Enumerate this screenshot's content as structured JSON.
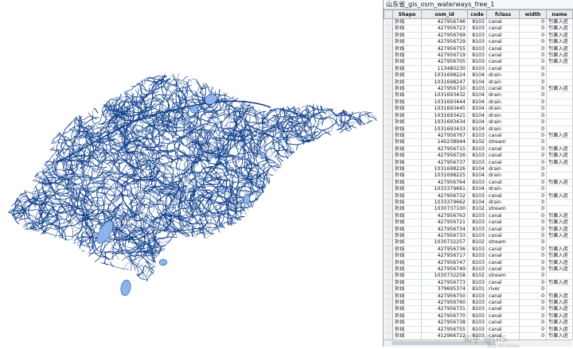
{
  "window": {
    "title": "山东省_gis_osm_waterways_free_1"
  },
  "map": {
    "waterway_color": "#0d3d8a",
    "waterbody_color": "#8cb4ea",
    "background_color": "#ffffff"
  },
  "table": {
    "columns": [
      "Shape",
      "osm_id",
      "code",
      "fclass",
      "width",
      "name"
    ],
    "rows": [
      [
        "折线",
        "427956746",
        "8103",
        "canal",
        "0",
        "引黄入运"
      ],
      [
        "折线",
        "427956723",
        "8103",
        "canal",
        "0",
        "引黄入运"
      ],
      [
        "折线",
        "427956769",
        "8103",
        "canal",
        "0",
        "引黄入运"
      ],
      [
        "折线",
        "427956729",
        "8103",
        "canal",
        "0",
        "引黄入运"
      ],
      [
        "折线",
        "427956755",
        "8103",
        "canal",
        "0",
        "引黄入运"
      ],
      [
        "折线",
        "427956719",
        "8103",
        "canal",
        "0",
        "引黄入运"
      ],
      [
        "折线",
        "427956705",
        "8103",
        "canal",
        "0",
        "引黄入运"
      ],
      [
        "折线",
        "113480230",
        "8103",
        "canal",
        "0",
        ""
      ],
      [
        "折线",
        "1031698224",
        "8104",
        "drain",
        "0",
        ""
      ],
      [
        "折线",
        "1031698247",
        "8104",
        "drain",
        "0",
        ""
      ],
      [
        "折线",
        "427956710",
        "8103",
        "canal",
        "0",
        "引黄入运"
      ],
      [
        "折线",
        "1031693432",
        "8104",
        "drain",
        "0",
        ""
      ],
      [
        "折线",
        "1031693444",
        "8104",
        "drain",
        "0",
        ""
      ],
      [
        "折线",
        "1031693445",
        "8104",
        "drain",
        "0",
        ""
      ],
      [
        "折线",
        "1031693421",
        "8104",
        "drain",
        "0",
        ""
      ],
      [
        "折线",
        "1031693434",
        "8104",
        "drain",
        "0",
        ""
      ],
      [
        "折线",
        "1031693433",
        "8104",
        "drain",
        "0",
        ""
      ],
      [
        "折线",
        "427956767",
        "8103",
        "canal",
        "0",
        "引黄入运"
      ],
      [
        "折线",
        "140238944",
        "8102",
        "stream",
        "0",
        ""
      ],
      [
        "折线",
        "427956715",
        "8103",
        "canal",
        "0",
        "引黄入运"
      ],
      [
        "折线",
        "427956726",
        "8103",
        "canal",
        "0",
        "引黄入运"
      ],
      [
        "折线",
        "427956737",
        "8103",
        "canal",
        "0",
        "引黄入运"
      ],
      [
        "折线",
        "1031698226",
        "8104",
        "drain",
        "0",
        ""
      ],
      [
        "折线",
        "1031698225",
        "8104",
        "drain",
        "0",
        ""
      ],
      [
        "折线",
        "427956764",
        "8103",
        "canal",
        "0",
        "引黄入运"
      ],
      [
        "折线",
        "1033379661",
        "8104",
        "drain",
        "0",
        ""
      ],
      [
        "折线",
        "427956732",
        "8103",
        "canal",
        "0",
        "引黄入运"
      ],
      [
        "折线",
        "1033379662",
        "8104",
        "drain",
        "0",
        ""
      ],
      [
        "折线",
        "1030737100",
        "8102",
        "stream",
        "0",
        ""
      ],
      [
        "折线",
        "427956763",
        "8103",
        "canal",
        "0",
        "引黄入运"
      ],
      [
        "折线",
        "427956721",
        "8103",
        "canal",
        "0",
        "引黄入运"
      ],
      [
        "折线",
        "427956734",
        "8103",
        "canal",
        "0",
        "引黄入运"
      ],
      [
        "折线",
        "427956733",
        "8103",
        "canal",
        "0",
        "引黄入运"
      ],
      [
        "折线",
        "1030732257",
        "8102",
        "stream",
        "0",
        ""
      ],
      [
        "折线",
        "427956736",
        "8103",
        "canal",
        "0",
        "引黄入运"
      ],
      [
        "折线",
        "427956717",
        "8103",
        "canal",
        "0",
        "引黄入运"
      ],
      [
        "折线",
        "427956747",
        "8103",
        "canal",
        "0",
        "引黄入运"
      ],
      [
        "折线",
        "427956749",
        "8103",
        "canal",
        "0",
        "引黄入运"
      ],
      [
        "折线",
        "1030732258",
        "8102",
        "stream",
        "0",
        ""
      ],
      [
        "折线",
        "427956773",
        "8103",
        "canal",
        "0",
        "引黄入运"
      ],
      [
        "折线",
        "379695374",
        "8101",
        "river",
        "0",
        ""
      ],
      [
        "折线",
        "427956750",
        "8103",
        "canal",
        "0",
        "引黄入运"
      ],
      [
        "折线",
        "427956760",
        "8103",
        "canal",
        "0",
        "引黄入运"
      ],
      [
        "折线",
        "427956731",
        "8103",
        "canal",
        "0",
        "引黄入运"
      ],
      [
        "折线",
        "427956770",
        "8103",
        "canal",
        "0",
        "引黄入运"
      ],
      [
        "折线",
        "427956738",
        "8103",
        "canal",
        "0",
        "引黄入运"
      ],
      [
        "折线",
        "427956755",
        "8103",
        "canal",
        "0",
        "引黄入运"
      ],
      [
        "折线",
        "412966722",
        "8103",
        "canal",
        "0",
        "引黄入运"
      ]
    ]
  },
  "watermark": {
    "main": "知乎 @GIS",
    "sub": "激活 Windows"
  }
}
